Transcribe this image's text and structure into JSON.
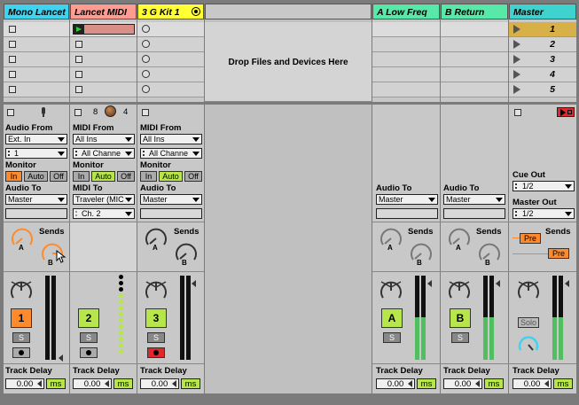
{
  "tracks": [
    {
      "name": "Mono Lancet",
      "color": "#3fd3f0"
    },
    {
      "name": "Lancet MIDI",
      "color": "#ff9b90"
    },
    {
      "name": "3 G Kit 1",
      "color": "#ffff33"
    },
    {
      "name": "A Low Freq",
      "color": "#58e8a8"
    },
    {
      "name": "B Return",
      "color": "#58e8a8"
    },
    {
      "name": "Master",
      "color": "#3fd3d0"
    }
  ],
  "drop_zone": "Drop Files and Devices Here",
  "scenes": [
    "1",
    "2",
    "3",
    "4",
    "5"
  ],
  "mono": {
    "audio_from_label": "Audio From",
    "audio_from_value": "Ext. In",
    "input_channel": "1",
    "monitor_label": "Monitor",
    "mon_in": "In",
    "mon_auto": "Auto",
    "mon_off": "Off",
    "audio_to_label": "Audio To",
    "audio_to_value": "Master",
    "sends_label": "Sends",
    "send_a": "A",
    "send_b": "B",
    "track_number": "1",
    "solo": "S",
    "delay_label": "Track Delay",
    "delay_value": "0.00",
    "delay_unit": "ms"
  },
  "midi": {
    "count_8": "8",
    "count_4": "4",
    "midi_from_label": "MIDI From",
    "midi_from_value": "All Ins",
    "channel_value": "All Channe",
    "monitor_label": "Monitor",
    "mon_in": "In",
    "mon_auto": "Auto",
    "mon_off": "Off",
    "midi_to_label": "MIDI To",
    "midi_to_value": "Traveler (MIC",
    "midi_channel": "Ch. 2",
    "track_number": "2",
    "solo": "S",
    "delay_label": "Track Delay",
    "delay_value": "0.00",
    "delay_unit": "ms"
  },
  "kit": {
    "midi_from_label": "MIDI From",
    "midi_from_value": "All Ins",
    "channel_value": "All Channe",
    "monitor_label": "Monitor",
    "mon_in": "In",
    "mon_auto": "Auto",
    "mon_off": "Off",
    "audio_to_label": "Audio To",
    "audio_to_value": "Master",
    "sends_label": "Sends",
    "send_a": "A",
    "send_b": "B",
    "track_number": "3",
    "solo": "S",
    "delay_label": "Track Delay",
    "delay_value": "0.00",
    "delay_unit": "ms"
  },
  "ret_a": {
    "audio_to_label": "Audio To",
    "audio_to_value": "Master",
    "sends_label": "Sends",
    "send_a": "A",
    "send_b": "B",
    "track_number": "A",
    "solo": "S",
    "delay_label": "Track Delay",
    "delay_value": "0.00",
    "delay_unit": "ms"
  },
  "ret_b": {
    "audio_to_label": "Audio To",
    "audio_to_value": "Master",
    "sends_label": "Sends",
    "send_a": "A",
    "send_b": "B",
    "track_number": "B",
    "solo": "S",
    "delay_label": "Track Delay",
    "delay_value": "0.00",
    "delay_unit": "ms"
  },
  "master": {
    "cue_out_label": "Cue Out",
    "cue_out_value": "1/2",
    "master_out_label": "Master Out",
    "master_out_value": "1/2",
    "sends_label": "Sends",
    "pre": "Pre",
    "solo": "Solo",
    "delay_label": "Track Delay",
    "delay_value": "0.00",
    "delay_unit": "ms"
  }
}
